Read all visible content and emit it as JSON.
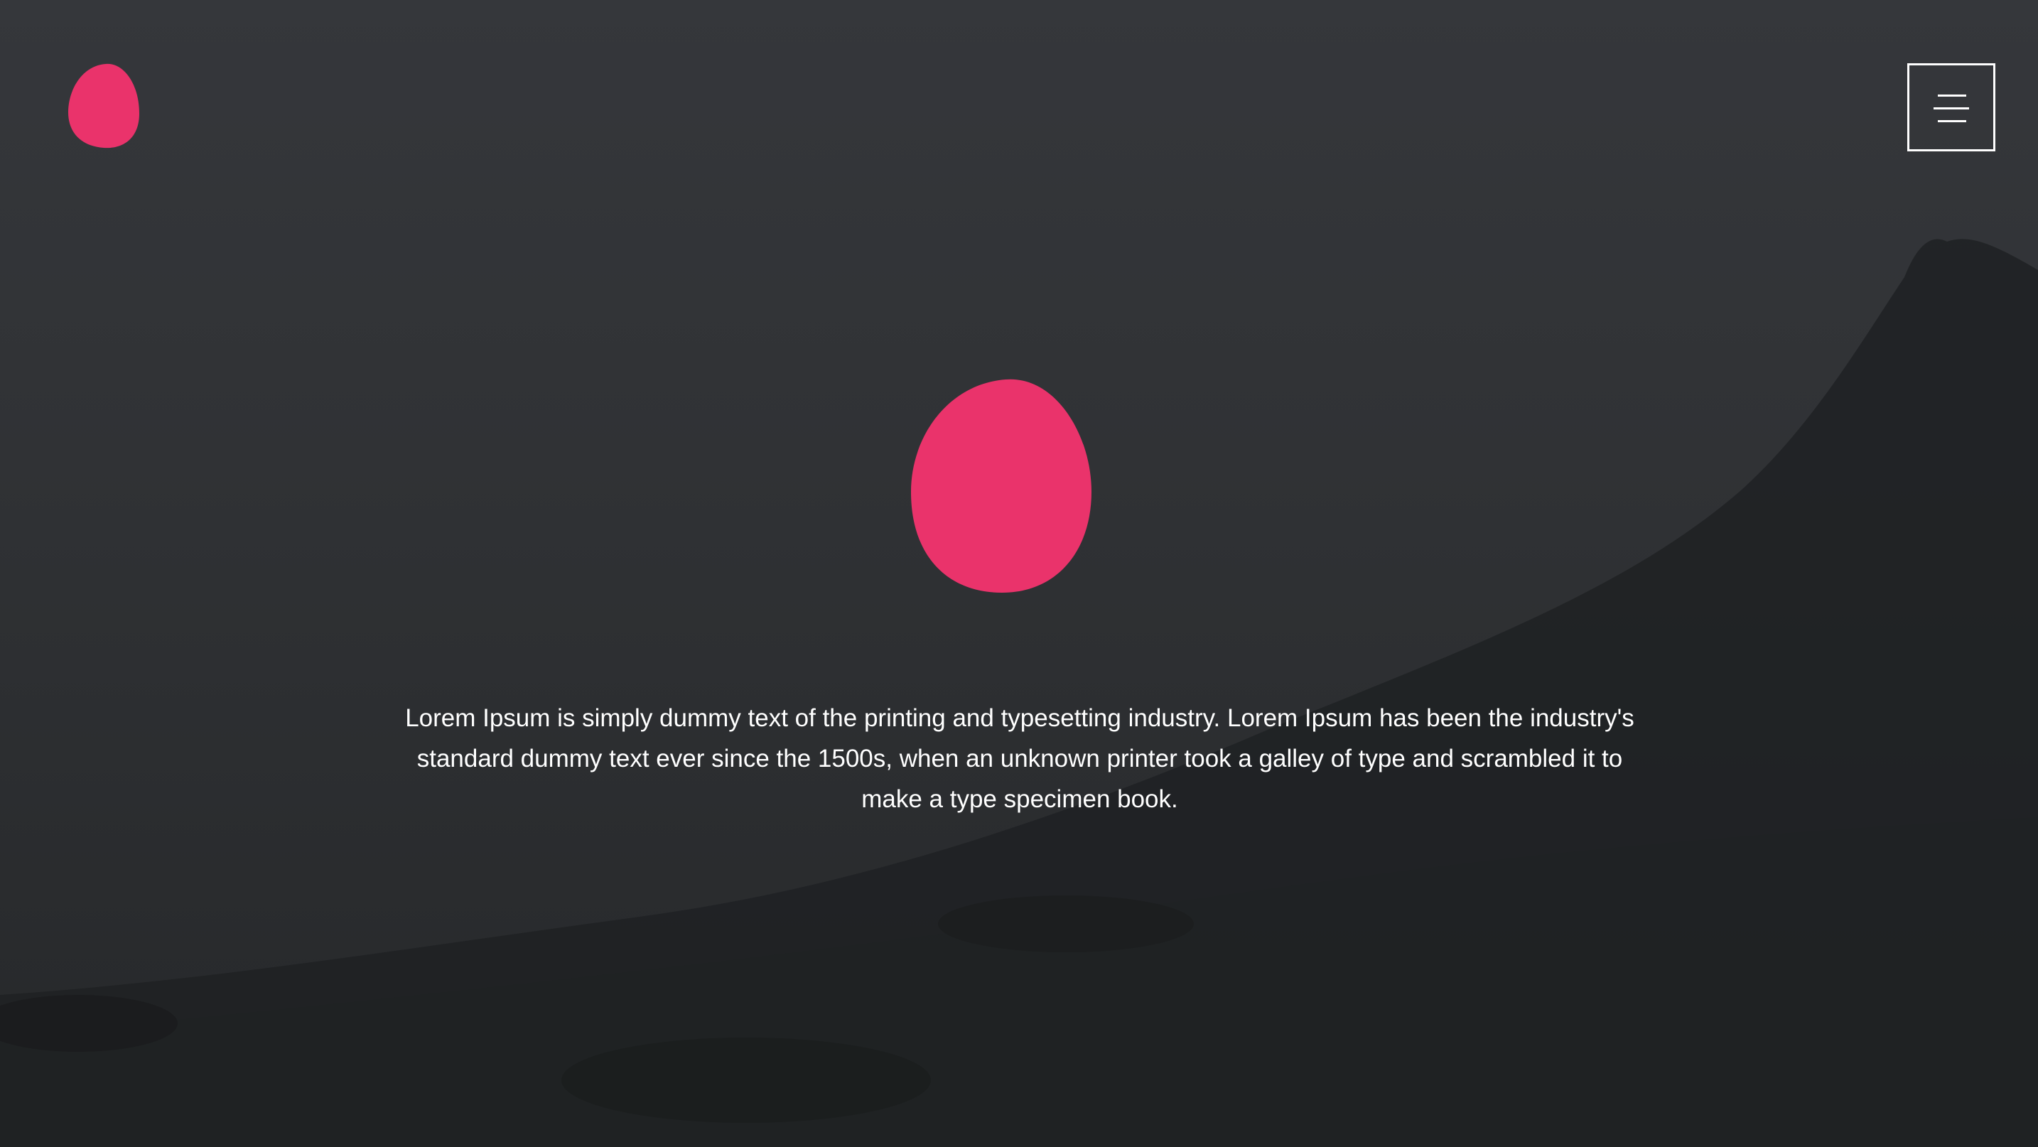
{
  "header": {
    "logo_icon": "egg-blob-icon",
    "menu_icon": "hamburger-menu-icon"
  },
  "hero": {
    "mark_icon": "egg-blob-icon",
    "description": "Lorem Ipsum is simply dummy text of the printing and typesetting industry. Lorem Ipsum has been the industry's standard dummy text ever since the 1500s, when an unknown printer took a galley of type and scrambled it to make a type specimen book."
  },
  "colors": {
    "accent": "#ea336b",
    "text": "#ffffff",
    "background": "#303235"
  }
}
